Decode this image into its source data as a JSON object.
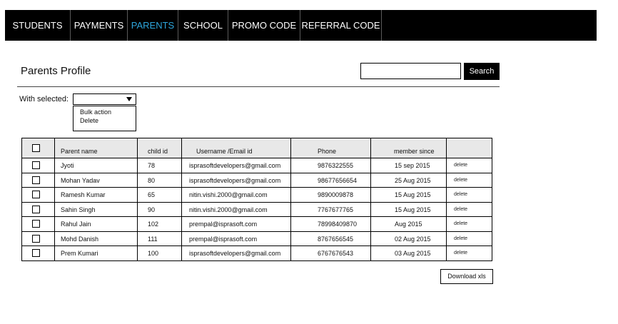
{
  "nav": {
    "items": [
      {
        "label": "STUDENTS",
        "active": false
      },
      {
        "label": "PAYMENTS",
        "active": false
      },
      {
        "label": "PARENTS",
        "active": true
      },
      {
        "label": "SCHOOL",
        "active": false
      },
      {
        "label": "PROMO CODE",
        "active": false
      },
      {
        "label": "REFERRAL CODE",
        "active": false
      }
    ],
    "active_color": "#2ea6dc"
  },
  "page": {
    "title": "Parents Profile",
    "search": {
      "value": "",
      "button_label": "Search"
    }
  },
  "bulk": {
    "label": "With selected:",
    "selected": "",
    "options": [
      "Bulk action",
      "Delete"
    ]
  },
  "table": {
    "columns": [
      "Parent name",
      "child id",
      "Username /Email id",
      "Phone",
      "member since",
      ""
    ],
    "rows": [
      {
        "name": "Jyoti",
        "child_id": "78",
        "email": "isprasoftdevelopers@gmail.com",
        "phone": "9876322555",
        "member_since": "15 sep 2015",
        "action": "delete"
      },
      {
        "name": "Mohan Yadav",
        "child_id": "80",
        "email": "isprasoftdevelopers@gmail.com",
        "phone": "98677656654",
        "member_since": "25 Aug 2015",
        "action": "delete"
      },
      {
        "name": "Ramesh Kumar",
        "child_id": "65",
        "email": "nitin.vishi.2000@gmail.com",
        "phone": "9890009878",
        "member_since": "15 Aug 2015",
        "action": "delete"
      },
      {
        "name": "Sahin Singh",
        "child_id": "90",
        "email": "nitin.vishi.2000@gmail.com",
        "phone": "7767677765",
        "member_since": "15 Aug 2015",
        "action": "delete"
      },
      {
        "name": "Rahul Jain",
        "child_id": "102",
        "email": "prempal@isprasoft.com",
        "phone": "78998409870",
        "member_since": "Aug 2015",
        "action": "delete"
      },
      {
        "name": "Mohd Danish",
        "child_id": "111",
        "email": "prempal@isprasoft.com",
        "phone": "8767656545",
        "member_since": "02 Aug 2015",
        "action": "delete"
      },
      {
        "name": "Prem Kumari",
        "child_id": "100",
        "email": "isprasoftdevelopers@gmail.com",
        "phone": "6767676543",
        "member_since": "03 Aug 2015",
        "action": "delete"
      }
    ]
  },
  "footer": {
    "download_label": "Download xls"
  }
}
